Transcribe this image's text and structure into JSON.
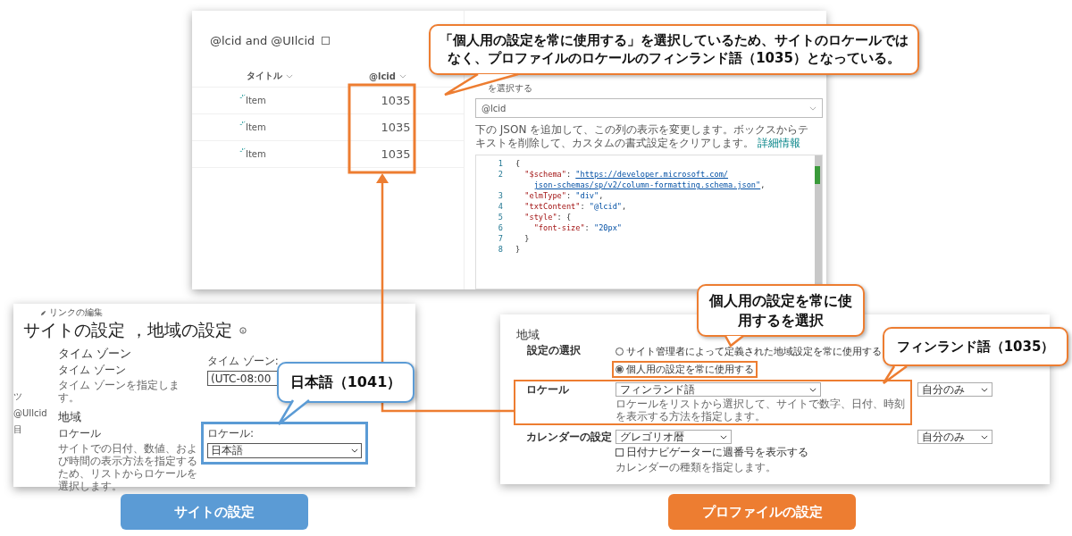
{
  "list_panel": {
    "title": "@lcid and @UIlcid",
    "columns": [
      "タイトル",
      "@lcid"
    ],
    "rows": [
      {
        "title": "Item",
        "lcid": "1035"
      },
      {
        "title": "Item",
        "lcid": "1035"
      },
      {
        "title": "Item",
        "lcid": "1035"
      }
    ]
  },
  "format_pane": {
    "partial_label": "を選択する",
    "column_select": "@lcid",
    "description": "下の JSON を追加して、この列の表示を変更します。ボックスからテキストを削除して、カスタムの書式設定をクリアします。",
    "link": "詳細情報",
    "code_lines": [
      {
        "number": "1",
        "tokens": [
          {
            "kind": "punct",
            "text": "{"
          }
        ]
      },
      {
        "number": "2",
        "tokens": [
          {
            "kind": "key",
            "text": "  \"$schema\""
          },
          {
            "kind": "punct",
            "text": ": "
          },
          {
            "kind": "string",
            "text": "\"https://developer.microsoft.com/"
          }
        ]
      },
      {
        "kind": "wrap",
        "tokens": [
          {
            "kind": "string",
            "text": "json-schemas/sp/v2/column-formatting.schema.json\""
          },
          {
            "kind": "punct",
            "text": ","
          }
        ]
      },
      {
        "number": "3",
        "tokens": [
          {
            "kind": "key",
            "text": "  \"elmType\""
          },
          {
            "kind": "punct",
            "text": ": "
          },
          {
            "kind": "string",
            "text": "\"div\""
          },
          {
            "kind": "punct",
            "text": ","
          }
        ]
      },
      {
        "number": "4",
        "tokens": [
          {
            "kind": "key",
            "text": "  \"txtContent\""
          },
          {
            "kind": "punct",
            "text": ": "
          },
          {
            "kind": "string",
            "text": "\"@lcid\""
          },
          {
            "kind": "punct",
            "text": ","
          }
        ]
      },
      {
        "number": "5",
        "tokens": [
          {
            "kind": "key",
            "text": "  \"style\""
          },
          {
            "kind": "punct",
            "text": ": {"
          }
        ]
      },
      {
        "number": "6",
        "tokens": [
          {
            "kind": "key",
            "text": "    \"font-size\""
          },
          {
            "kind": "punct",
            "text": ": "
          },
          {
            "kind": "string",
            "text": "\"20px\""
          }
        ]
      },
      {
        "number": "7",
        "tokens": [
          {
            "kind": "punct",
            "text": "  }"
          }
        ]
      },
      {
        "number": "8",
        "tokens": [
          {
            "kind": "punct",
            "text": "}"
          }
        ]
      }
    ]
  },
  "site_panel": {
    "breadcrumb": "リンクの編集",
    "title": "サイトの設定 ，地域の設定",
    "cut_texts": [
      "ツ",
      "@UIlcid",
      "目"
    ],
    "sections": [
      {
        "heading": "タイム ゾーン",
        "subheading": "タイム ゾーン",
        "description": "タイム ゾーンを指定します。",
        "field_label": "タイム ゾーン:",
        "value": "(UTC-08:00"
      },
      {
        "heading": "地域",
        "subheading": "ロケール",
        "description": "サイトでの日付、数値、および時間の表示方法を指定するため、リストからロケールを選択します。",
        "field_label": "ロケール:",
        "value": "日本語"
      }
    ]
  },
  "profile_panel": {
    "heading": "地域",
    "choice_label": "設定の選択",
    "radios": [
      {
        "label": "サイト管理者によって定義された地域設定を常に使用する",
        "selected": false
      },
      {
        "label": "個人用の設定を常に使用する",
        "selected": true
      }
    ],
    "rows": [
      {
        "label": "ロケール",
        "value": "フィンランド語",
        "description": "ロケールをリストから選択して、サイトで数字、日付、時刻を表示する方法を指定します。",
        "scope": "自分のみ"
      },
      {
        "label": "カレンダーの設定",
        "value": "グレゴリオ暦",
        "checkbox": {
          "label": "日付ナビゲーターに週番号を表示する",
          "checked": false
        },
        "description": "カレンダーの種類を指定します。",
        "scope": "自分のみ"
      }
    ]
  },
  "callouts": [
    {
      "text": "「個人用の設定を常に使用する」を選択しているため、サイトのロケールではなく、プロファイルのロケールのフィンランド語（1035）となっている。",
      "color": "#ed7d31"
    },
    {
      "text": "日本語（1041）",
      "color": "#5b9bd5"
    },
    {
      "text": "個人用の設定を常に使用するを選択",
      "color": "#ed7d31"
    },
    {
      "text": "フィンランド語（1035）",
      "color": "#ed7d31"
    }
  ],
  "labels": [
    {
      "text": "サイトの設定",
      "color": "#5b9bd5"
    },
    {
      "text": "プロファイルの設定",
      "color": "#ed7d31"
    }
  ]
}
